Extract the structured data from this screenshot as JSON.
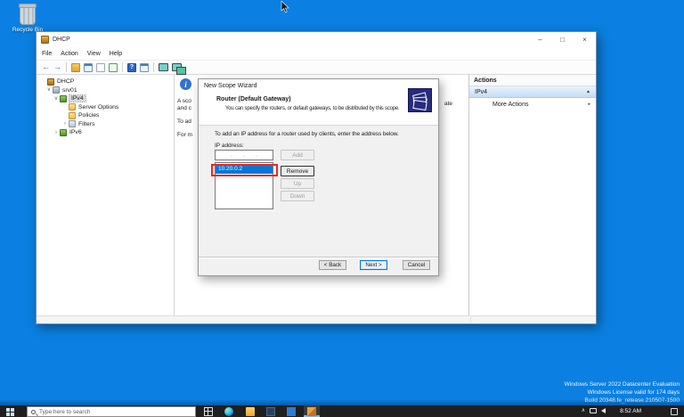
{
  "desktop": {
    "recycle_bin_label": "Recycle Bin",
    "watermark_lines": [
      "Windows Server 2022 Datacenter Evaluation",
      "Windows License valid for 174 days",
      "Build 20348.fe_release.210507-1500"
    ]
  },
  "icons": {
    "back_arrow": "←",
    "forward_arrow": "→",
    "help_glyph": "?",
    "tree_expanded": "∨",
    "tree_collapsed": "›",
    "collapse_arrow": "▲",
    "more_arrow": "▸",
    "info_glyph": "i",
    "tray_up": "∧"
  },
  "dhcp_window": {
    "title": "DHCP",
    "caption_buttons": {
      "minimize": "–",
      "maximize": "□",
      "close": "×"
    },
    "menu_items": {
      "file": "File",
      "action": "Action",
      "view": "View",
      "help": "Help"
    },
    "tree": {
      "items": [
        {
          "label": "DHCP"
        },
        {
          "label": "srv01"
        },
        {
          "label": "IPv4"
        },
        {
          "label": "Server Options"
        },
        {
          "label": "Policies"
        },
        {
          "label": "Filters"
        },
        {
          "label": "IPv6"
        }
      ]
    },
    "pane_fragments": {
      "f1": "A sco",
      "f2": "and c",
      "f3": "To ad",
      "f4": "For m",
      "f5": "ate"
    },
    "actions_panel": {
      "header": "Actions",
      "scope_row": "IPv4",
      "more_actions": "More Actions"
    }
  },
  "wizard": {
    "title": "New Scope Wizard",
    "heading": "Router (Default Gateway)",
    "description": "You can specify the routers, or default gateways, to be distributed by this scope.",
    "instruction": "To add an IP address for a router used by clients, enter the address below.",
    "ip_label": "IP address:",
    "ip_input_value": ".   .   .",
    "router_list": [
      {
        "ip": "10.20.0.2",
        "selected": true
      }
    ],
    "buttons": {
      "add": "Add",
      "remove": "Remove",
      "up": "Up",
      "down": "Down",
      "back": "< Back",
      "next": "Next >",
      "cancel": "Cancel"
    }
  },
  "taskbar": {
    "search_placeholder": "Type here to search",
    "clock_time": "8:52 AM"
  },
  "colors": {
    "desktop_blue": "#0b80e2",
    "selection_blue": "#0078d7",
    "annotation_red": "#df2b28",
    "taskbar_dark": "#1f1f1f",
    "wizard_icon_navy": "#272c7d"
  }
}
